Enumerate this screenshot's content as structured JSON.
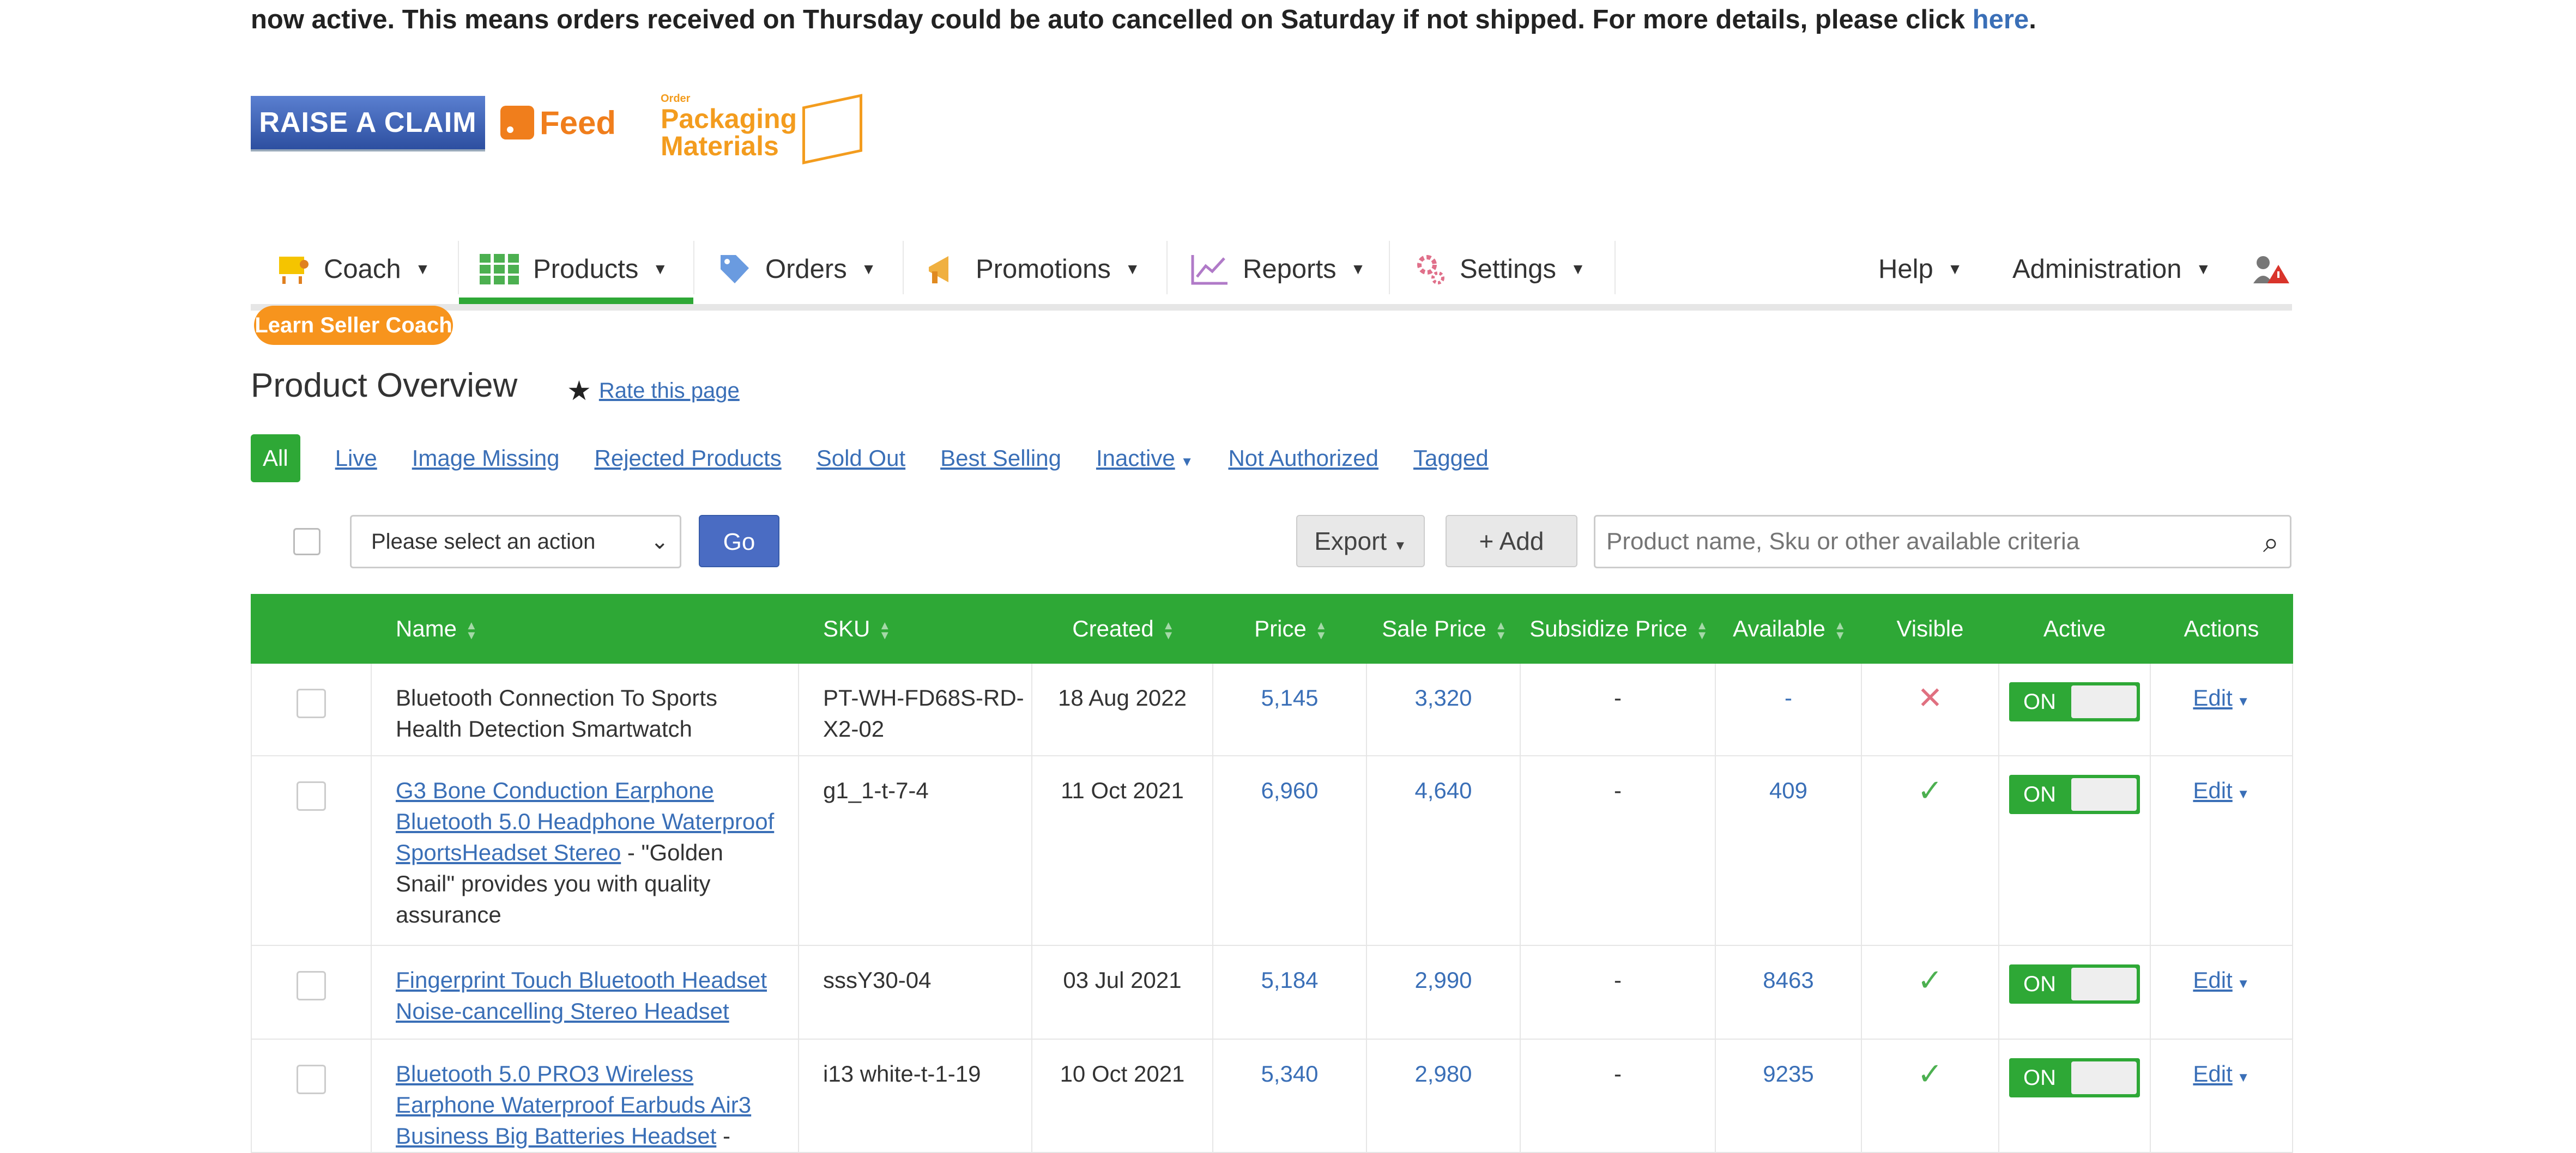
{
  "notice": {
    "text": "now active. This means orders received on Thursday could be auto cancelled on Saturday if not shipped. For more details, please click ",
    "link": "here",
    "tail": "."
  },
  "logos": {
    "raise_claim": "RAISE A CLAIM",
    "feed": "Feed",
    "packaging_small": "Order",
    "packaging_line1": "Packaging",
    "packaging_line2": "Materials"
  },
  "nav": {
    "items": [
      {
        "label": "Coach",
        "icon": "coach-icon"
      },
      {
        "label": "Products",
        "icon": "grid-icon"
      },
      {
        "label": "Orders",
        "icon": "tag-icon"
      },
      {
        "label": "Promotions",
        "icon": "megaphone-icon"
      },
      {
        "label": "Reports",
        "icon": "chart-icon"
      },
      {
        "label": "Settings",
        "icon": "gear-icon"
      }
    ],
    "right": [
      {
        "label": "Help"
      },
      {
        "label": "Administration"
      }
    ],
    "colors": {
      "active": "#2ea836"
    }
  },
  "coach_button": "Learn Seller Coach",
  "page": {
    "title": "Product Overview",
    "rate": "Rate this page"
  },
  "filters": {
    "all": "All",
    "items": [
      "Live",
      "Image Missing",
      "Rejected Products",
      "Sold Out",
      "Best Selling",
      "Inactive",
      "Not Authorized",
      "Tagged"
    ]
  },
  "toolbar": {
    "action_select": "Please select an action",
    "go": "Go",
    "export": "Export",
    "add": "Add",
    "search_placeholder": "Product name, Sku or other available criteria"
  },
  "table": {
    "headers": [
      "Name",
      "SKU",
      "Created",
      "Price",
      "Sale Price",
      "Subsidize Price",
      "Available",
      "Visible",
      "Active",
      "Actions"
    ],
    "toggle_on": "ON",
    "edit_label": "Edit",
    "rows": [
      {
        "name_text": "Bluetooth Connection To Sports Health Detection Smartwatch",
        "name_link": "",
        "name_suffix": "",
        "sku": "PT-WH-FD68S-RD-X2-02",
        "created": "18 Aug 2022",
        "price": "5,145",
        "sale_price": "3,320",
        "subsidize": "-",
        "available": "-",
        "visible": "✕"
      },
      {
        "name_text": "",
        "name_link": "G3 Bone Conduction Earphone Bluetooth 5.0 Headphone Waterproof SportsHeadset Stereo",
        "name_suffix": " - \"Golden Snail\" provides you with quality assurance",
        "sku": "g1_1-t-7-4",
        "created": "11 Oct 2021",
        "price": "6,960",
        "sale_price": "4,640",
        "subsidize": "-",
        "available": "409",
        "visible": "✓"
      },
      {
        "name_text": "",
        "name_link": "Fingerprint Touch Bluetooth Headset Noise-cancelling Stereo Headset",
        "name_suffix": "",
        "sku": "sssY30-04",
        "created": "03 Jul 2021",
        "price": "5,184",
        "sale_price": "2,990",
        "subsidize": "-",
        "available": "8463",
        "visible": "✓"
      },
      {
        "name_text": "",
        "name_link": "Bluetooth 5.0 PRO3 Wireless Earphone Waterproof Earbuds Air3 Business Big Batteries Headset",
        "name_suffix": " -",
        "sku": "i13 white-t-1-19",
        "created": "10 Oct 2021",
        "price": "5,340",
        "sale_price": "2,980",
        "subsidize": "-",
        "available": "9235",
        "visible": "✓"
      }
    ]
  }
}
